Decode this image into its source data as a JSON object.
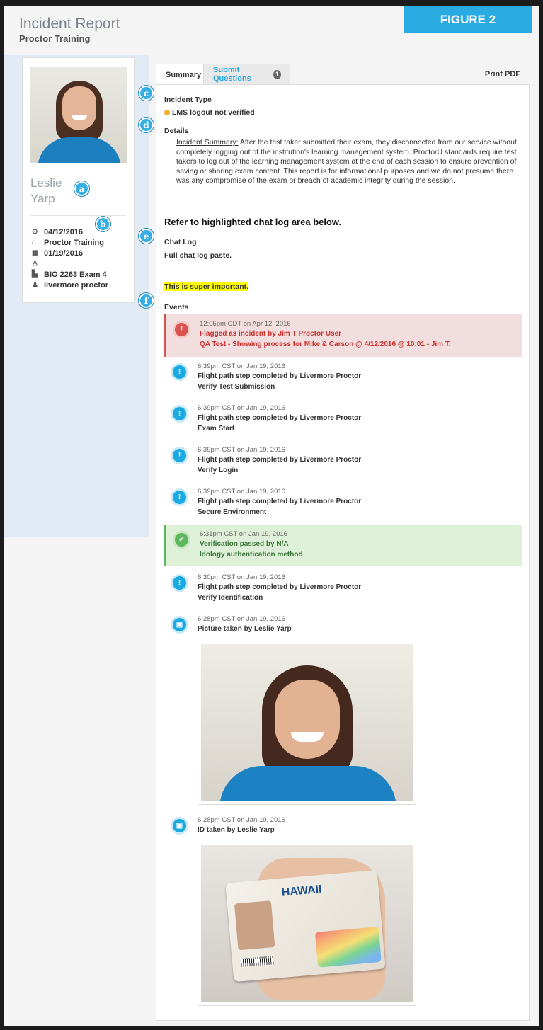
{
  "header": {
    "title": "Incident Report",
    "subtitle": "Proctor Training"
  },
  "figure_label": "FIGURE 2",
  "profile": {
    "name_first": "Leslie",
    "name_last": "Yarp",
    "meta": [
      {
        "icon": "clock-icon",
        "glyph": "⊙",
        "value": "04/12/2016"
      },
      {
        "icon": "graduation-cap-icon",
        "glyph": "⌂",
        "value": "Proctor Training"
      },
      {
        "icon": "calendar-icon",
        "glyph": "▦",
        "value": "01/19/2016"
      },
      {
        "icon": "person-icon",
        "glyph": "♙",
        "value": ""
      },
      {
        "icon": "file-icon",
        "glyph": "▙",
        "value": "BIO 2263 Exam 4"
      },
      {
        "icon": "group-icon",
        "glyph": "♟",
        "value": "livermore proctor"
      }
    ]
  },
  "badges": [
    "a",
    "b",
    "c",
    "d",
    "e",
    "f"
  ],
  "tabs": {
    "summary": "Summary",
    "submit_questions": "Submit Questions",
    "submit_count": "1",
    "print": "Print PDF"
  },
  "incident_type": {
    "label": "Incident Type",
    "value": "LMS logout not verified",
    "status_color": "#f0ad2e"
  },
  "details": {
    "label": "Details",
    "lead": "Incident Summary:",
    "text": " After the test taker submitted their exam, they disconnected from our service without completely logging out of the institution's learning management system. ProctorU standards require test takers to log out of the learning management system at the end of each session to ensure prevention of saving or sharing exam content. This report is for informational purposes and we do not presume there was any compromise of the exam or breach of academic integrity during the session."
  },
  "callout": "Refer to highlighted chat log area below.",
  "chat_log": {
    "label": "Chat Log",
    "content": "Full chat log paste.",
    "highlight": "This is super important."
  },
  "events": {
    "label": "Events",
    "items": [
      {
        "time": "12:05pm CDT on Apr 12, 2016",
        "action": "Flagged as incident by Jim T Proctor User",
        "detail": "QA Test - Showing process for Mike & Carson @ 4/12/2016 @ 10:01 - Jim T."
      },
      {
        "time": "6:39pm CST on Jan 19, 2016",
        "action": "Flight path step completed by Livermore Proctor",
        "detail": "Verify Test Submission"
      },
      {
        "time": "6:39pm CST on Jan 19, 2016",
        "action": "Flight path step completed by Livermore Proctor",
        "detail": "Exam Start"
      },
      {
        "time": "6:39pm CST on Jan 19, 2016",
        "action": "Flight path step completed by Livermore Proctor",
        "detail": "Verify Login"
      },
      {
        "time": "6:39pm CST on Jan 19, 2016",
        "action": "Flight path step completed by Livermore Proctor",
        "detail": "Secure Environment"
      },
      {
        "time": "6:31pm CST on Jan 19, 2016",
        "action": "Verification passed by N/A",
        "detail": "Idology authentication method"
      },
      {
        "time": "6:30pm CST on Jan 19, 2016",
        "action": "Flight path step completed by Livermore Proctor",
        "detail": "Verify Identification"
      },
      {
        "time": "6:28pm CST on Jan 19, 2016",
        "action": "Picture taken by Leslie Yarp"
      },
      {
        "time": "6:28pm CST on Jan 19, 2016",
        "action": "ID taken by Leslie Yarp"
      }
    ]
  },
  "id_card": {
    "title": "HAWAII"
  },
  "colors": {
    "accent": "#29abe2",
    "danger": "#d9534f",
    "success": "#5cb85c",
    "warning": "#f0ad2e"
  }
}
